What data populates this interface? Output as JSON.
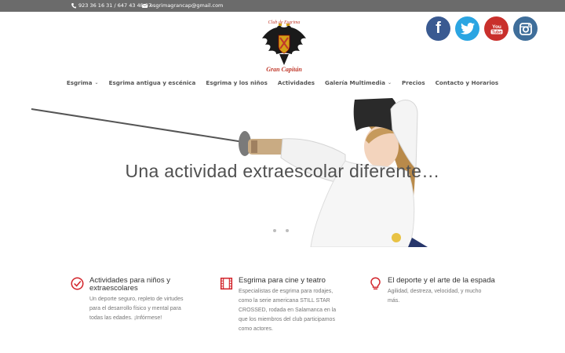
{
  "topbar": {
    "phone": "923 36 16 31 / 647 43 48 87",
    "email": "esgrimagrancap@gmail.com"
  },
  "header": {
    "logo_top_text": "Club de Esgrima",
    "logo_bottom_text": "Gran Capitán",
    "social": [
      {
        "name": "facebook-icon",
        "glyph": "f",
        "color": "#3a5a91"
      },
      {
        "name": "twitter-icon",
        "glyph": "",
        "color": "#2ba5e2"
      },
      {
        "name": "youtube-icon",
        "glyph": "You Tube",
        "color": "#c9302c"
      },
      {
        "name": "instagram-icon",
        "glyph": "",
        "color": "#3f6e9a"
      }
    ]
  },
  "nav": {
    "items": [
      {
        "label": "Esgrima",
        "dropdown": true
      },
      {
        "label": "Esgrima antigua y escénica",
        "dropdown": false
      },
      {
        "label": "Esgrima y los niños",
        "dropdown": false
      },
      {
        "label": "Actividades",
        "dropdown": false
      },
      {
        "label": "Galería Multimedia",
        "dropdown": true
      },
      {
        "label": "Precios",
        "dropdown": false
      },
      {
        "label": "Contacto y Horarios",
        "dropdown": false
      }
    ]
  },
  "hero": {
    "title": "Una actividad extraescolar diferente…",
    "slides": 2
  },
  "features": [
    {
      "icon": "check-circle-icon",
      "title": "Actividades para niños y extraescolares",
      "text": [
        "Un deporte seguro, repleto de virtudes",
        "para el desarrollo físico y mental para",
        "todas las edades. ¡Infórmese!"
      ]
    },
    {
      "icon": "film-icon",
      "title": "Esgrima para cine y teatro",
      "text": [
        "Especialistas de esgrima para rodajes,",
        "como la serie americana STILL STAR",
        "CROSSED, rodada en Salamanca en la",
        "que los miembros del club participamos",
        "como actores."
      ]
    },
    {
      "icon": "lightbulb-icon",
      "title": "El deporte y el arte de la espada",
      "text": [
        "Agilidad, destreza, velocidad, y mucho",
        "más."
      ]
    }
  ],
  "colors": {
    "topbar": "#6b6b6b",
    "accent_red": "#d2232a",
    "nav_text": "#555555"
  }
}
